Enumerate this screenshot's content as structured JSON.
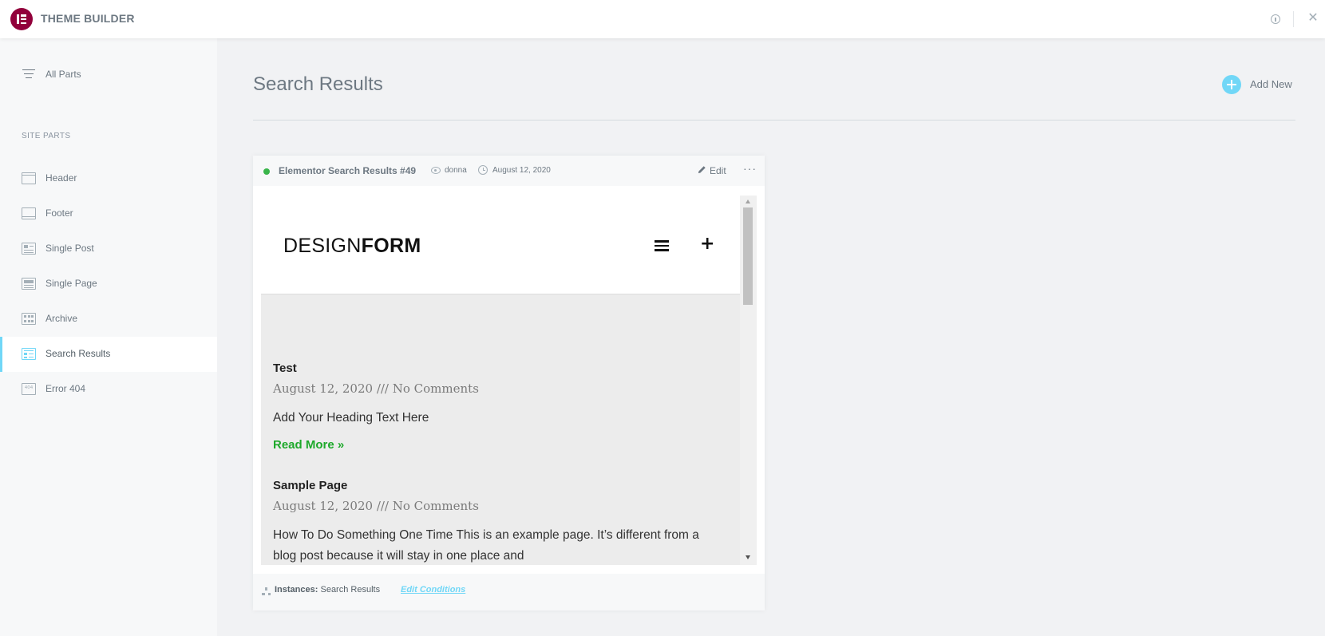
{
  "app": {
    "title": "THEME BUILDER"
  },
  "topbar": {
    "info_icon": "info-icon",
    "close_icon": "close-icon",
    "close_glyph": "✕"
  },
  "sidebar": {
    "all_parts_label": "All Parts",
    "section_label": "SITE PARTS",
    "items": [
      {
        "label": "Header",
        "icon": "header-icon",
        "active": false
      },
      {
        "label": "Footer",
        "icon": "footer-icon",
        "active": false
      },
      {
        "label": "Single Post",
        "icon": "single-post-icon",
        "active": false
      },
      {
        "label": "Single Page",
        "icon": "single-page-icon",
        "active": false
      },
      {
        "label": "Archive",
        "icon": "archive-icon",
        "active": false
      },
      {
        "label": "Search Results",
        "icon": "search-results-icon",
        "active": true
      },
      {
        "label": "Error 404",
        "icon": "error-404-icon",
        "active": false
      }
    ],
    "error_icon_text": "404"
  },
  "main": {
    "title": "Search Results",
    "add_new_label": "Add New"
  },
  "card": {
    "title": "Elementor Search Results #49",
    "status": "published",
    "author": "donna",
    "date": "August 12, 2020",
    "edit_label": "Edit",
    "more_glyph": "···",
    "instances_label": "Instances:",
    "instances_value": "Search Results",
    "edit_conditions_label": "Edit Conditions"
  },
  "preview": {
    "logo_light": "DESIGN",
    "logo_bold": "FORM",
    "plus_glyph": "+",
    "posts": [
      {
        "title": "Test",
        "meta": "August 12, 2020 /// No Comments",
        "excerpt": "Add Your Heading Text Here",
        "read_more": "Read More »"
      },
      {
        "title": "Sample Page",
        "meta": "August 12, 2020 /// No Comments",
        "excerpt": "How To Do Something One Time This is an example page. It’s different from a blog post because it will stay in one place and",
        "read_more": ""
      }
    ]
  },
  "colors": {
    "brand": "#92003b",
    "accent": "#71d7f7",
    "status_green": "#39b54a",
    "read_more_green": "#1ea92b"
  }
}
